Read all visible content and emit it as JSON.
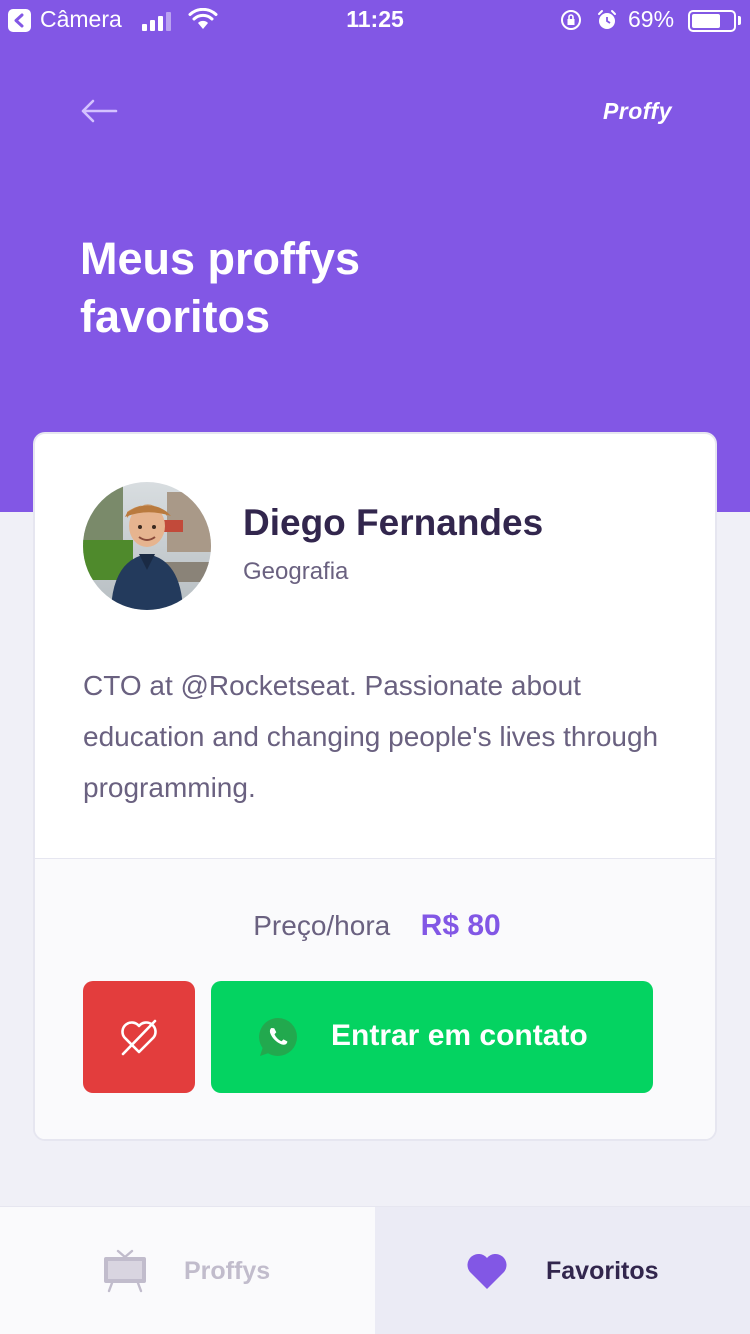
{
  "status_bar": {
    "back_app": "Câmera",
    "time": "11:25",
    "battery_percent": "69%",
    "battery_level": 0.69
  },
  "header": {
    "logo": "Proffy",
    "title": "Meus proffys favoritos"
  },
  "teacher_card": {
    "name": "Diego Fernandes",
    "subject": "Geografia",
    "bio": "CTO at @Rocketseat. Passionate about education and changing people's lives through programming.",
    "price_label": "Preço/hora",
    "price_value": "R$ 80",
    "contact_label": "Entrar em contato"
  },
  "tab_bar": {
    "tabs": [
      {
        "label": "Proffys",
        "icon": "tv-icon",
        "active": false
      },
      {
        "label": "Favoritos",
        "icon": "heart-icon",
        "active": true
      }
    ]
  },
  "colors": {
    "primary": "#8257E5",
    "danger": "#E33D3D",
    "success": "#04D361",
    "title": "#32264D",
    "text": "#6A6180",
    "background": "#F0F0F7"
  }
}
